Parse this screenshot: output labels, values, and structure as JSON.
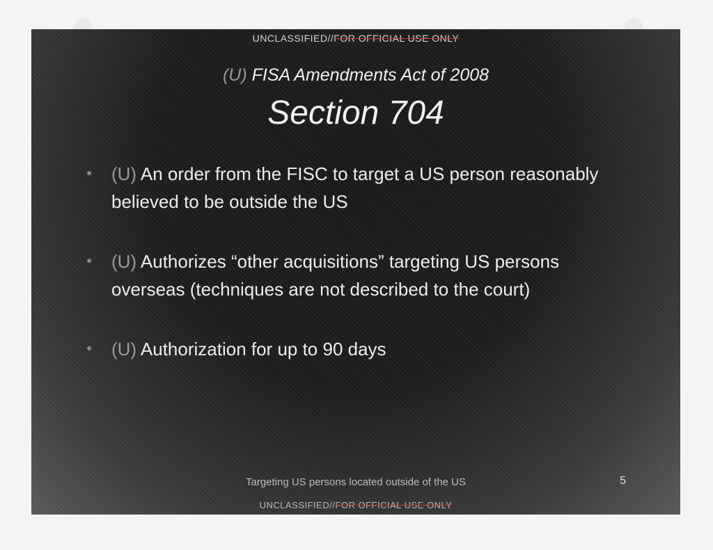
{
  "classification": {
    "top_label": "UNCLASSIFIED//",
    "top_struck": "FOR OFFICIAL USE ONLY",
    "bottom_label": "UNCLASSIFIED//",
    "bottom_struck": "FOR OFFICIAL USE ONLY"
  },
  "slide": {
    "title_marking": "(U)",
    "title": "FISA Amendments Act of 2008",
    "section": "Section 704",
    "bullets": [
      {
        "marking": "(U)",
        "text": "An order from the FISC to target a US person reasonably believed to be outside the US"
      },
      {
        "marking": "(U)",
        "text": "Authorizes “other acquisitions” targeting US persons overseas (techniques are not described to the court)"
      },
      {
        "marking": "(U)",
        "text": "Authorization for up to 90 days"
      }
    ],
    "footer": "Targeting US persons located outside of the US",
    "page_number": "5"
  }
}
